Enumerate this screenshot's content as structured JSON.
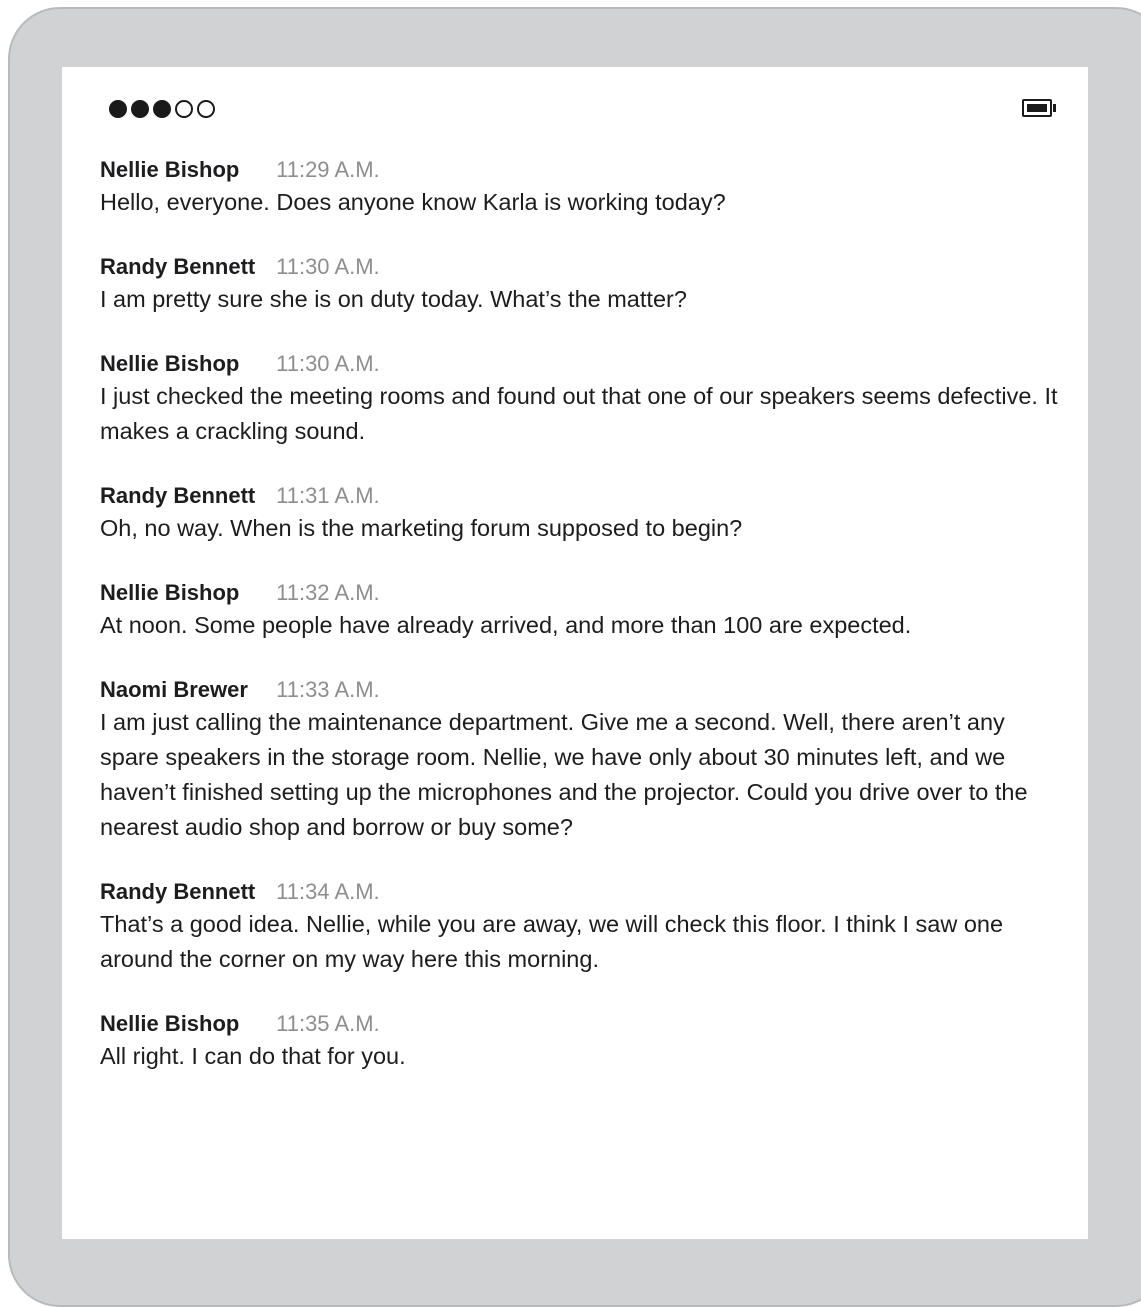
{
  "status_bar": {
    "signal_strength": 3,
    "signal_max": 5,
    "battery_icon": "battery-icon"
  },
  "messages": [
    {
      "sender": "Nellie Bishop",
      "time": "11:29 A.M.",
      "text": "Hello, everyone. Does anyone know Karla is working today?"
    },
    {
      "sender": "Randy Bennett",
      "time": "11:30 A.M.",
      "text": "I am pretty sure she is on duty today. What’s the matter?"
    },
    {
      "sender": "Nellie Bishop",
      "time": "11:30 A.M.",
      "text": "I just checked the meeting rooms and found out that one of our speakers seems defective. It makes a crackling sound."
    },
    {
      "sender": "Randy Bennett",
      "time": "11:31 A.M.",
      "text": "Oh, no way. When is the marketing forum supposed to begin?"
    },
    {
      "sender": "Nellie Bishop",
      "time": "11:32 A.M.",
      "text": "At noon. Some people have already arrived, and more than 100 are expected."
    },
    {
      "sender": "Naomi Brewer",
      "time": "11:33 A.M.",
      "text": "I am just calling the maintenance department. Give me a second. Well, there aren’t any spare speakers in the storage room. Nellie, we have only about 30 minutes left, and we haven’t finished setting up the microphones and the projector. Could you drive over to the nearest audio shop and borrow or buy some?"
    },
    {
      "sender": "Randy Bennett",
      "time": "11:34 A.M.",
      "text": "That’s a good idea. Nellie, while you are away, we will check this floor. I think I saw one around the corner on my way here this morning."
    },
    {
      "sender": "Nellie Bishop",
      "time": "11:35 A.M.",
      "text": "All right. I can do that for you."
    }
  ]
}
